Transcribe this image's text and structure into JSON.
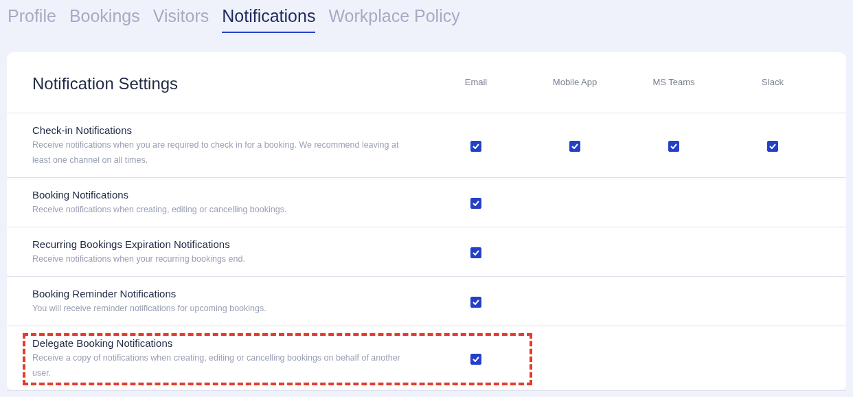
{
  "tabs": [
    {
      "label": "Profile",
      "selected": false
    },
    {
      "label": "Bookings",
      "selected": false
    },
    {
      "label": "Visitors",
      "selected": false
    },
    {
      "label": "Notifications",
      "selected": true
    },
    {
      "label": "Workplace Policy",
      "selected": false
    }
  ],
  "settings": {
    "title": "Notification Settings",
    "columns": [
      "Email",
      "Mobile App",
      "MS Teams",
      "Slack"
    ],
    "rows": [
      {
        "title": "Check-in Notifications",
        "description": "Receive notifications when you are required to check in for a booking. We recommend leaving at least one channel on all times.",
        "highlighted": false,
        "channels": [
          {
            "checked": true
          },
          {
            "checked": true
          },
          {
            "checked": true
          },
          {
            "checked": true
          }
        ]
      },
      {
        "title": "Booking Notifications",
        "description": "Receive notifications when creating, editing or cancelling bookings.",
        "highlighted": false,
        "channels": [
          {
            "checked": true
          }
        ]
      },
      {
        "title": "Recurring Bookings Expiration Notifications",
        "description": "Receive notifications when your recurring bookings end.",
        "highlighted": false,
        "channels": [
          {
            "checked": true
          }
        ]
      },
      {
        "title": "Booking Reminder Notifications",
        "description": "You will receive reminder notifications for upcoming bookings.",
        "highlighted": false,
        "channels": [
          {
            "checked": true
          }
        ]
      },
      {
        "title": "Delegate Booking Notifications",
        "description": "Receive a copy of notifications when creating, editing or cancelling bookings on behalf of another user.",
        "highlighted": true,
        "channels": [
          {
            "checked": true
          }
        ]
      }
    ]
  }
}
